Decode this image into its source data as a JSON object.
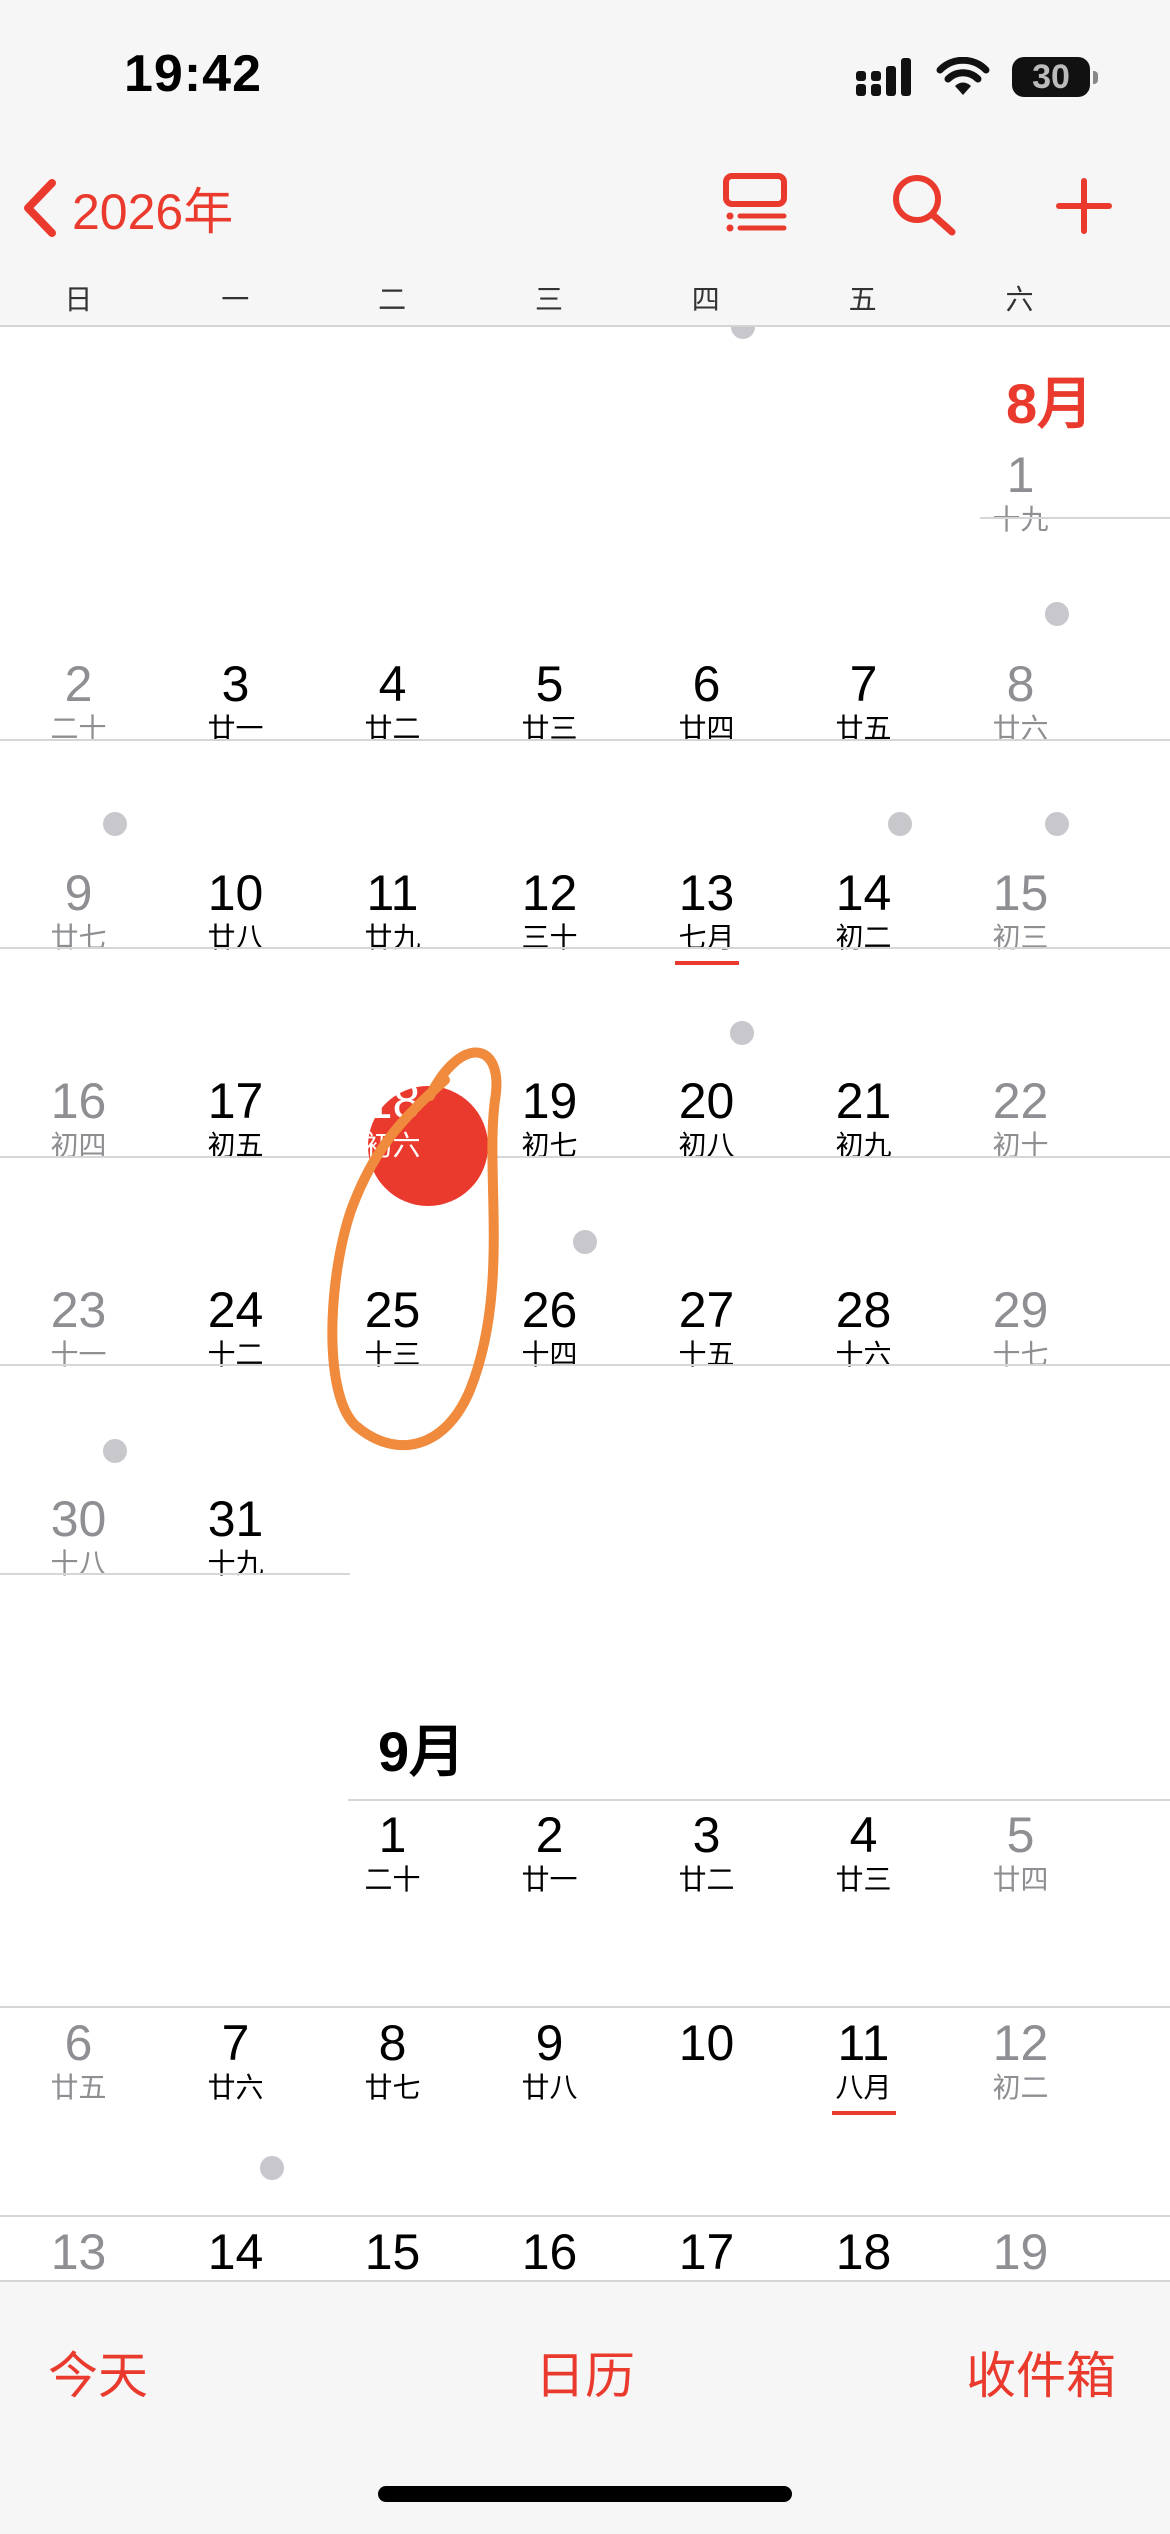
{
  "status_bar": {
    "time": "19:42",
    "battery": "30"
  },
  "nav": {
    "back_label": "2026年"
  },
  "weekdays": [
    "日",
    "一",
    "二",
    "三",
    "四",
    "五",
    "六"
  ],
  "august": {
    "title": "8月",
    "days": [
      {
        "n": "1",
        "l": "十九"
      },
      {
        "n": "2",
        "l": "二十"
      },
      {
        "n": "3",
        "l": "廿一"
      },
      {
        "n": "4",
        "l": "廿二"
      },
      {
        "n": "5",
        "l": "廿三"
      },
      {
        "n": "6",
        "l": "廿四"
      },
      {
        "n": "7",
        "l": "廿五"
      },
      {
        "n": "8",
        "l": "廿六"
      },
      {
        "n": "9",
        "l": "廿七"
      },
      {
        "n": "10",
        "l": "廿八"
      },
      {
        "n": "11",
        "l": "廿九"
      },
      {
        "n": "12",
        "l": "三十"
      },
      {
        "n": "13",
        "l": "七月"
      },
      {
        "n": "14",
        "l": "初二"
      },
      {
        "n": "15",
        "l": "初三"
      },
      {
        "n": "16",
        "l": "初四"
      },
      {
        "n": "17",
        "l": "初五"
      },
      {
        "n": "18",
        "l": "初六"
      },
      {
        "n": "19",
        "l": "初七"
      },
      {
        "n": "20",
        "l": "初八"
      },
      {
        "n": "21",
        "l": "初九"
      },
      {
        "n": "22",
        "l": "初十"
      },
      {
        "n": "23",
        "l": "十一"
      },
      {
        "n": "24",
        "l": "十二"
      },
      {
        "n": "25",
        "l": "十三"
      },
      {
        "n": "26",
        "l": "十四"
      },
      {
        "n": "27",
        "l": "十五"
      },
      {
        "n": "28",
        "l": "十六"
      },
      {
        "n": "29",
        "l": "十七"
      },
      {
        "n": "30",
        "l": "十八"
      },
      {
        "n": "31",
        "l": "十九"
      }
    ]
  },
  "september": {
    "title": "9月",
    "days": [
      {
        "n": "1",
        "l": "二十"
      },
      {
        "n": "2",
        "l": "廿一"
      },
      {
        "n": "3",
        "l": "廿二"
      },
      {
        "n": "4",
        "l": "廿三"
      },
      {
        "n": "5",
        "l": "廿四"
      },
      {
        "n": "6",
        "l": "廿五"
      },
      {
        "n": "7",
        "l": "廿六"
      },
      {
        "n": "8",
        "l": "廿七"
      },
      {
        "n": "9",
        "l": "廿八"
      },
      {
        "n": "10",
        "l": ""
      },
      {
        "n": "11",
        "l": "八月"
      },
      {
        "n": "12",
        "l": "初二"
      },
      {
        "n": "13",
        "l": ""
      },
      {
        "n": "14",
        "l": ""
      },
      {
        "n": "15",
        "l": ""
      },
      {
        "n": "16",
        "l": ""
      },
      {
        "n": "17",
        "l": ""
      },
      {
        "n": "18",
        "l": ""
      },
      {
        "n": "19",
        "l": ""
      }
    ]
  },
  "toolbar": {
    "today": "今天",
    "calendars": "日历",
    "inbox": "收件箱"
  },
  "colors": {
    "accent": "#ea3a2d",
    "weekend": "#8e8e93",
    "event_dot": "#c7c7cc",
    "annotation": "#f08a3c"
  }
}
